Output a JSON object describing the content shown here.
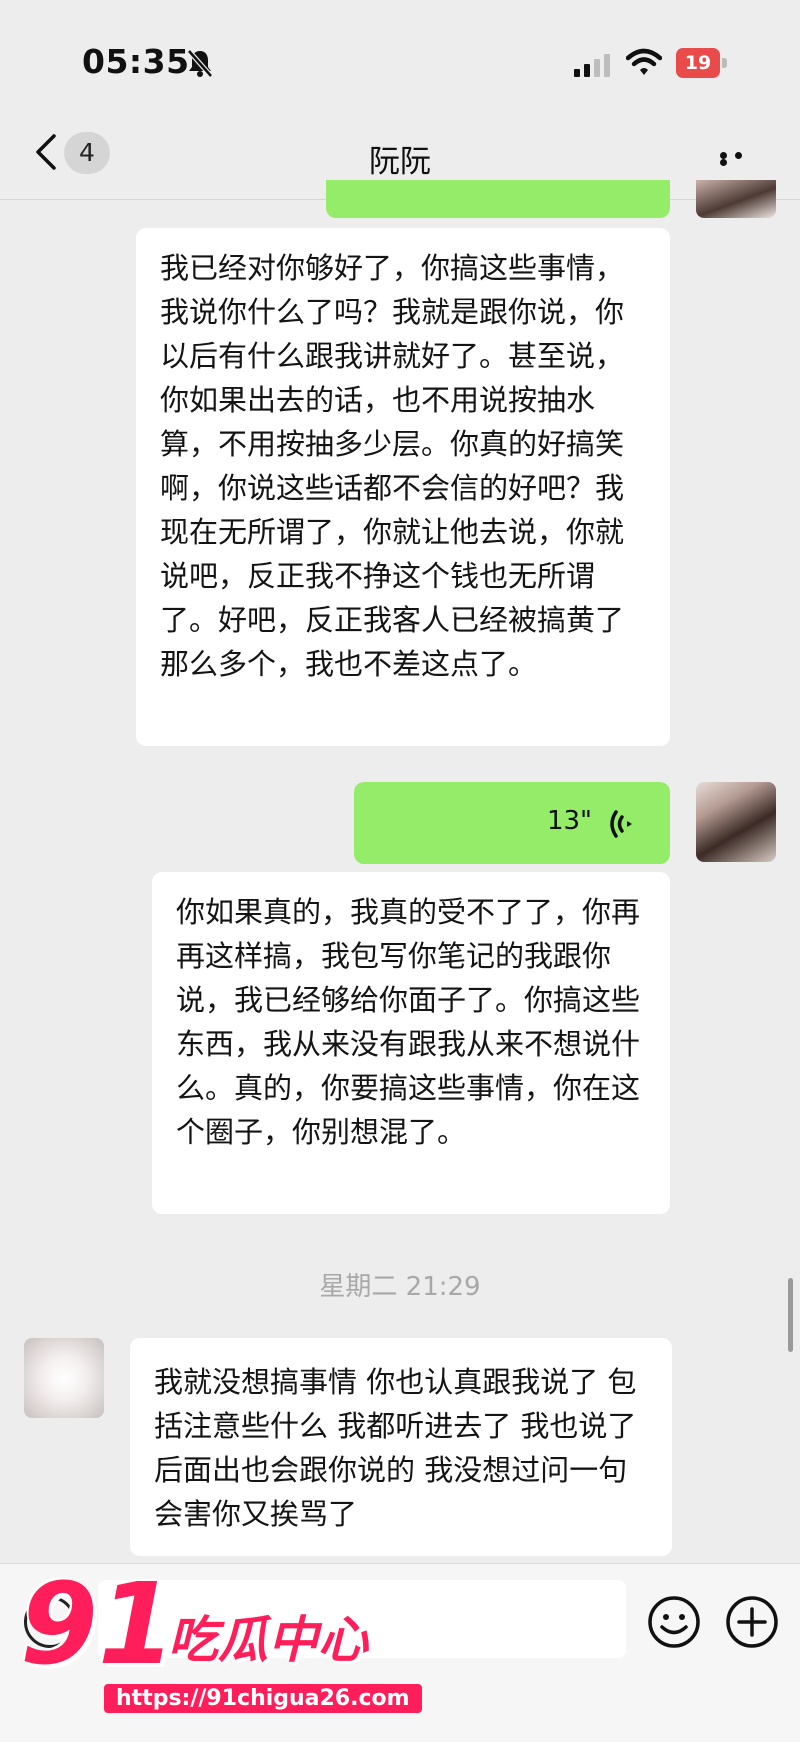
{
  "status_bar": {
    "time": "05:35",
    "battery": "19",
    "icons": [
      "bell-off-icon",
      "signal-icon",
      "wifi-icon",
      "battery-icon"
    ]
  },
  "nav": {
    "unread_count": "4",
    "title": "阮阮",
    "icons": [
      "back-arrow-icon",
      "more-icon"
    ]
  },
  "messages": [
    {
      "side": "left",
      "type": "text",
      "text": "我已经对你够好了，你搞这些事情，我说你什么了吗？我就是跟你说，你以后有什么跟我讲就好了。甚至说，你如果出去的话，也不用说按抽水算，不用按抽多少层。你真的好搞笑啊，你说这些话都不会信的好吧？我现在无所谓了，你就让他去说，你就说吧，反正我不挣这个钱也无所谓了。好吧，反正我客人已经被搞黄了那么多个，我也不差这点了。"
    },
    {
      "side": "right",
      "type": "voice",
      "duration": "13\""
    },
    {
      "side": "right",
      "type": "transcript",
      "text": "你如果真的，我真的受不了了，你再再这样搞，我包写你笔记的我跟你说，我已经够给你面子了。你搞这些东西，我从来没有跟我从来不想说什么。真的，你要搞这些事情，你在这个圈子，你别想混了。"
    },
    {
      "side": "left",
      "type": "text",
      "text": "我就没想搞事情 你也认真跟我说了 包括注意些什么 我都听进去了 我也说了后面出也会跟你说的 我没想过问一句会害你又挨骂了"
    }
  ],
  "timestamp": "星期二 21:29",
  "input_bar": {
    "placeholder": "",
    "icons": [
      "voice-toggle-icon",
      "emoji-icon",
      "add-icon"
    ]
  },
  "watermark": {
    "number": "91",
    "name": "吃瓜中心",
    "url": "https://91chigua26.com"
  },
  "colors": {
    "background": "#ededed",
    "bubble_green": "#95ec69",
    "bubble_white": "#ffffff",
    "watermark": "#ff1e5a"
  }
}
